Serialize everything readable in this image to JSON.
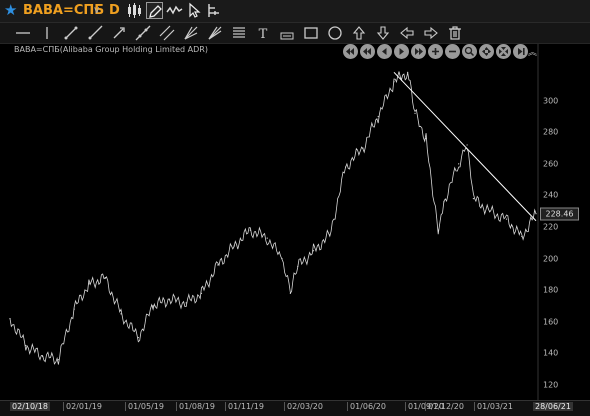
{
  "toolbar": {
    "symbol": "BABA=СПБ",
    "period": "D",
    "icons": [
      "star-icon",
      "chevron-down-icon",
      "candle-icon",
      "pen-icon",
      "line-style-icon",
      "cursor-icon",
      "indicator-icon"
    ]
  },
  "drawbar": {
    "icons": [
      "horizontal-line-icon",
      "vertical-line-icon",
      "trend-line-icon",
      "ray-icon",
      "arrow-line-icon",
      "extended-line-icon",
      "channel-icon",
      "fork-icon",
      "fibonacci-icon",
      "text-icon",
      "price-label-icon",
      "rectangle-icon",
      "circle-icon",
      "arrow-up-icon",
      "arrow-down-icon",
      "arrow-left-icon",
      "arrow-right-icon",
      "trash-icon"
    ]
  },
  "chart_data": {
    "type": "line",
    "title": "BABA=СПБ(Alibaba Group Holding Limited ADR)",
    "x": [
      "2018-10-02",
      "2018-11-01",
      "2018-12-03",
      "2019-01-02",
      "2019-02-01",
      "2019-03-01",
      "2019-04-01",
      "2019-05-01",
      "2019-06-03",
      "2019-07-01",
      "2019-08-01",
      "2019-09-02",
      "2019-10-01",
      "2019-11-01",
      "2019-12-02",
      "2020-01-02",
      "2020-02-03",
      "2020-03-02",
      "2020-03-18",
      "2020-04-01",
      "2020-05-01",
      "2020-06-01",
      "2020-07-01",
      "2020-08-03",
      "2020-09-01",
      "2020-10-01",
      "2020-10-27",
      "2020-11-10",
      "2020-12-01",
      "2020-12-24",
      "2021-01-04",
      "2021-02-01",
      "2021-02-17",
      "2021-03-01",
      "2021-04-01",
      "2021-05-03",
      "2021-06-01",
      "2021-06-28"
    ],
    "series": [
      {
        "values": [
          162,
          145,
          138,
          136,
          168,
          184,
          188,
          165,
          150,
          170,
          174,
          172,
          178,
          196,
          208,
          218,
          213,
          200,
          178,
          195,
          205,
          215,
          258,
          270,
          290,
          312,
          318,
          292,
          276,
          218,
          236,
          260,
          272,
          238,
          230,
          225,
          214,
          228.46
        ]
      },
      {
        "values": [
          null,
          null,
          null,
          null,
          null,
          null,
          null,
          null,
          null,
          null,
          null,
          null,
          null,
          null,
          null,
          null,
          null,
          null,
          null,
          null,
          null,
          null,
          null,
          null,
          null,
          318,
          null,
          null,
          null,
          null,
          null,
          null,
          274,
          null,
          null,
          null,
          null,
          224
        ]
      }
    ],
    "y_ticks": [
      120,
      140,
      160,
      180,
      200,
      220,
      240,
      260,
      280,
      300
    ],
    "ylim": [
      113,
      322
    ],
    "last_price": "228.46",
    "x_labels": [
      "02/10/18",
      "02/01/19",
      "01/05/19",
      "01/08/19",
      "01/11/19",
      "02/03/20",
      "01/06/20",
      "01/09/20",
      "01/12/20",
      "01/03/21",
      "28/06/21"
    ],
    "trendline": {
      "from": [
        "2020-10-01",
        318
      ],
      "to": [
        "2021-06-28",
        224
      ]
    },
    "grid": false
  },
  "colors": {
    "background": "#000000",
    "price_line": "#d8d8d8",
    "trendline": "#ffffff",
    "symbol": "#f0a020",
    "star": "#2e8fe0"
  }
}
